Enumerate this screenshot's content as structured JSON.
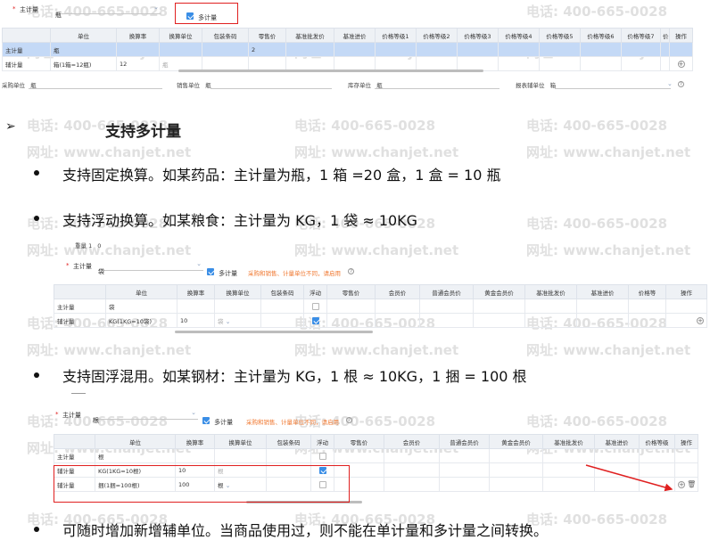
{
  "colors": {
    "accent": "#3a8ee6",
    "highlight": "#e02020",
    "warn": "#f07830"
  },
  "screen1": {
    "main_unit_label": "主计量",
    "main_unit_value": "瓶",
    "multi_unit_label": "多计量",
    "headers": [
      "单位",
      "换算率",
      "换算单位",
      "包装条码",
      "零售价",
      "基准批发价",
      "基准进价",
      "价格等级1",
      "价格等级2",
      "价格等级3",
      "价格等级4",
      "价格等级5",
      "价格等级6",
      "价格等级7",
      "价",
      "操作"
    ],
    "rows": [
      {
        "type": "主计量",
        "unit": "瓶",
        "rate": "",
        "conv": "",
        "barcode": "",
        "retail": "2"
      },
      {
        "type": "辅计量",
        "unit": "箱(1箱=12瓶)",
        "rate": "12",
        "conv": "瓶",
        "barcode": "",
        "retail": ""
      }
    ],
    "purchase_label": "采购单位",
    "purchase_value": "瓶",
    "sales_label": "销售单位",
    "sales_value": "瓶",
    "stock_label": "库存单位",
    "stock_value": "瓶",
    "report_label": "报表辅单位",
    "report_value": "箱"
  },
  "heading": "支持多计量",
  "bullets": [
    "支持固定换算。如某药品：主计量为瓶，1 箱 =20 盒，1 盒 = 10 瓶",
    "支持浮动换算。如某粮食：主计量为 KG，1 袋 ≈ 10KG",
    "支持固浮混用。如某钢材：主计量为 KG，1 根 ≈ 10KG，1 捆 = 100 根",
    "可随时增加新增辅单位。当商品使用过，则不能在单计量和多计量之间转换。"
  ],
  "screen2": {
    "weight_label": "重量",
    "weight_value": "1",
    "weight_unit": "0",
    "main_unit_label": "主计量",
    "main_unit_value": "袋",
    "multi_unit_label": "多计量",
    "notice": "采购和销售、计量单位不同，请启用",
    "headers": [
      "",
      "单位",
      "换算率",
      "换算单位",
      "包装条码",
      "浮动",
      "零售价",
      "会员价",
      "普通会员价",
      "黄金会员价",
      "基准批发价",
      "基准进价",
      "价格等",
      "操作"
    ],
    "rows": [
      {
        "type": "主计量",
        "unit": "袋",
        "rate": "",
        "conv": "",
        "float": false
      },
      {
        "type": "辅计量",
        "unit": "KG(1KG=10袋)",
        "rate": "10",
        "conv": "袋",
        "float": true
      }
    ]
  },
  "screen3": {
    "main_unit_label": "主计量",
    "main_unit_value": "根",
    "multi_unit_label": "多计量",
    "notice": "采购和销售、计量单位不同，请启用",
    "headers": [
      "",
      "单位",
      "换算率",
      "换算单位",
      "包装条码",
      "浮动",
      "零售价",
      "会员价",
      "普通会员价",
      "黄金会员价",
      "基准批发价",
      "基准进价",
      "价格等级",
      "操作"
    ],
    "rows": [
      {
        "type": "主计量",
        "unit": "根",
        "rate": "",
        "conv": "",
        "float": false
      },
      {
        "type": "辅计量",
        "unit": "KG(1KG=10根)",
        "rate": "10",
        "conv": "根",
        "float": true
      },
      {
        "type": "辅计量",
        "unit": "捆(1捆=100根)",
        "rate": "100",
        "conv": "根",
        "float": false
      }
    ]
  },
  "watermark": {
    "phone": "电话: 400-665-0028",
    "site": "网址: www.chanjet.net"
  }
}
